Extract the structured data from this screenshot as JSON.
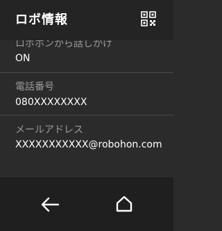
{
  "header": {
    "title": "ロボ情報",
    "qr_icon": "qr-code-icon"
  },
  "settings": [
    {
      "label": "ロボホンから話しかけ",
      "value": "ON"
    },
    {
      "label": "電話番号",
      "value": "080XXXXXXXX"
    },
    {
      "label": "メールアドレス",
      "value": "XXXXXXXXXXX@robohon.com"
    }
  ],
  "nav": {
    "back_icon": "back-arrow-icon",
    "home_icon": "home-icon"
  },
  "colors": {
    "background": "#2b2b2b",
    "app_bar": "#242424",
    "label": "#9a9a9a",
    "value": "#ffffff",
    "nav_bar": "#1f1f1f"
  }
}
